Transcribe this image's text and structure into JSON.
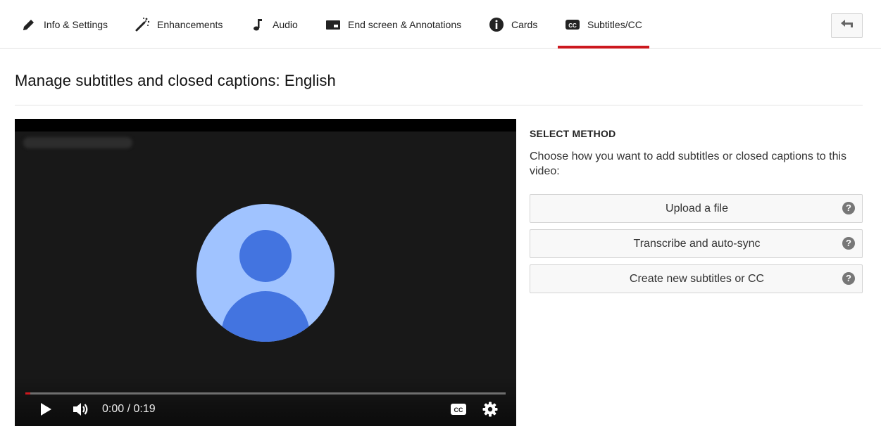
{
  "tabs": [
    {
      "label": "Info & Settings",
      "icon": "pencil-icon"
    },
    {
      "label": "Enhancements",
      "icon": "magic-wand-icon"
    },
    {
      "label": "Audio",
      "icon": "music-note-icon"
    },
    {
      "label": "End screen & Annotations",
      "icon": "end-screen-icon"
    },
    {
      "label": "Cards",
      "icon": "info-icon"
    },
    {
      "label": "Subtitles/CC",
      "icon": "cc-icon",
      "active": true
    }
  ],
  "back_button_icon": "back-arrow-icon",
  "page": {
    "title": "Manage subtitles and closed captions: English"
  },
  "player": {
    "time": "0:00 / 0:19",
    "progress": 0.01,
    "controls": [
      "play-icon",
      "volume-icon",
      "cc-icon",
      "settings-gear-icon"
    ]
  },
  "method": {
    "heading": "SELECT METHOD",
    "description": "Choose how you want to add subtitles or closed captions to this video:",
    "buttons": [
      {
        "label": "Upload a file",
        "help": "?"
      },
      {
        "label": "Transcribe and auto-sync",
        "help": "?"
      },
      {
        "label": "Create new subtitles or CC",
        "help": "?"
      }
    ]
  },
  "colors": {
    "accent": "#cc181e",
    "avatar_bg": "#a0c3ff",
    "avatar_fg": "#4374e0",
    "player_bg": "#181818"
  }
}
